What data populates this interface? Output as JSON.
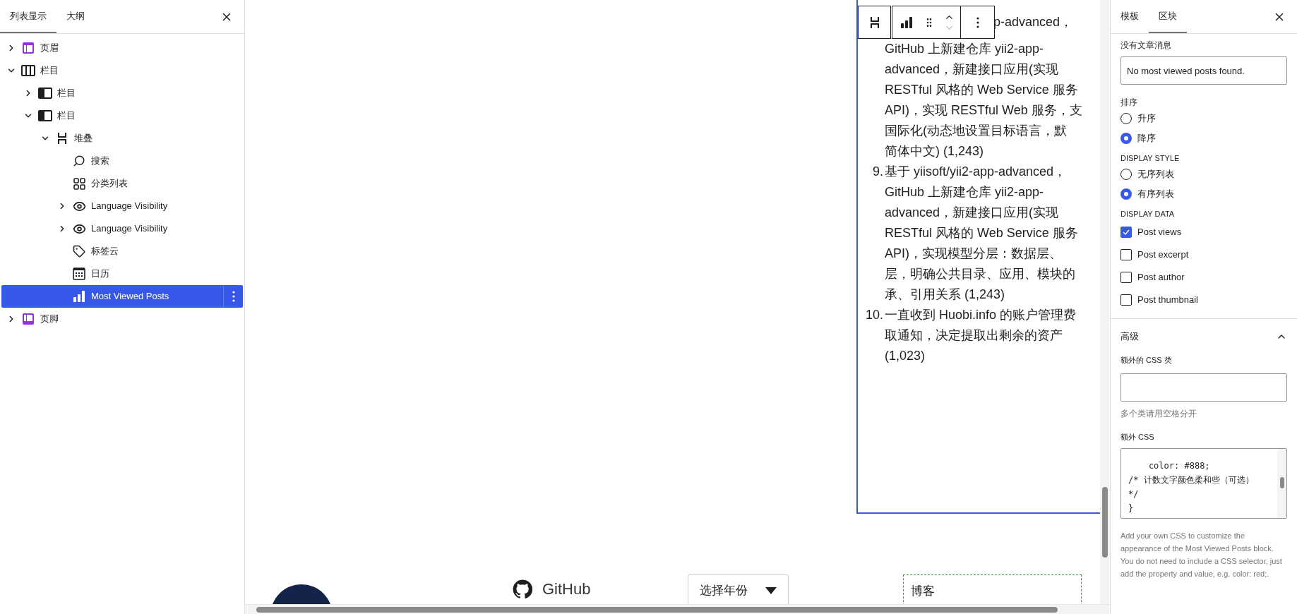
{
  "list_view": {
    "tabs": [
      {
        "label": "列表显示",
        "selected": true
      },
      {
        "label": "大纲",
        "selected": false
      }
    ],
    "tree": [
      {
        "kind": "header",
        "label": "页眉",
        "expanded": false,
        "selected": false
      },
      {
        "kind": "columns",
        "label": "栏目",
        "expanded": true,
        "selected": false,
        "children": [
          {
            "kind": "column",
            "label": "栏目",
            "expanded": false,
            "selected": false
          },
          {
            "kind": "column",
            "label": "栏目",
            "expanded": true,
            "selected": false,
            "children": [
              {
                "kind": "stack",
                "label": "堆叠",
                "expanded": true,
                "selected": false,
                "children": [
                  {
                    "kind": "search",
                    "label": "搜索",
                    "selected": false
                  },
                  {
                    "kind": "categories",
                    "label": "分类列表",
                    "selected": false
                  },
                  {
                    "kind": "visibility",
                    "label": "Language Visibility",
                    "expanded": false,
                    "selected": false
                  },
                  {
                    "kind": "visibility",
                    "label": "Language Visibility",
                    "expanded": false,
                    "selected": false
                  },
                  {
                    "kind": "tags",
                    "label": "标签云",
                    "selected": false
                  },
                  {
                    "kind": "calendar",
                    "label": "日历",
                    "selected": false
                  },
                  {
                    "kind": "chart",
                    "label": "Most Viewed Posts",
                    "selected": true
                  }
                ]
              }
            ]
          }
        ]
      },
      {
        "kind": "footer",
        "label": "页脚",
        "expanded": false,
        "selected": false
      }
    ]
  },
  "canvas": {
    "top_fragment": "p-advanced，",
    "items": [
      {
        "lines": [
          "GitHub 上新建仓库 yii2-app-",
          "advanced，新建接口应用(实现",
          "RESTful 风格的 Web Service 服务",
          "API)，实现 RESTful Web 服务，支",
          "国际化(动态地设置目标语言，默",
          "简体中文) (1,243)"
        ]
      },
      {
        "number": "9.",
        "lines": [
          "基于 yiisoft/yii2-app-advanced，",
          "GitHub 上新建仓库 yii2-app-",
          "advanced，新建接口应用(实现",
          "RESTful 风格的 Web Service 服务",
          "API)，实现模型分层：数据层、",
          "层，明确公共目录、应用、模块的",
          "承、引用关系 (1,243)"
        ]
      },
      {
        "number": "10.",
        "lines": [
          "一直收到 Huobi.info 的账户管理费",
          "取通知，决定提取出剩余的资产",
          "(1,023)"
        ]
      }
    ],
    "footer_row": {
      "github_label": "GitHub",
      "year_select": "选择年份",
      "blog_heading": "博客"
    }
  },
  "inspector": {
    "tabs": [
      {
        "label": "模板",
        "selected": false
      },
      {
        "label": "区块",
        "selected": true
      }
    ],
    "no_posts_message": {
      "label": "没有文章消息",
      "value": "No most viewed posts found."
    },
    "order": {
      "label": "排序",
      "options": [
        {
          "label": "升序",
          "selected": false
        },
        {
          "label": "降序",
          "selected": true
        }
      ]
    },
    "display_style": {
      "label": "DISPLAY STYLE",
      "options": [
        {
          "label": "无序列表",
          "selected": false
        },
        {
          "label": "有序列表",
          "selected": true
        }
      ]
    },
    "display_data": {
      "label": "DISPLAY DATA",
      "options": [
        {
          "label": "Post views",
          "checked": true
        },
        {
          "label": "Post excerpt",
          "checked": false
        },
        {
          "label": "Post author",
          "checked": false
        },
        {
          "label": "Post thumbnail",
          "checked": false
        }
      ]
    },
    "advanced": {
      "title": "高级",
      "expanded": true,
      "css_class": {
        "label": "额外的 CSS 类",
        "help": "多个类请用空格分开"
      },
      "custom_css": {
        "label": "额外 CSS",
        "value": "    color: #888;\n/* 计数文字颜色柔和些（可选）\n*/\n}",
        "help": "Add your own CSS to customize the appearance of the Most Viewed Posts block. You do not need to include a CSS selector, just add the property and value, e.g. color: red;."
      }
    }
  }
}
